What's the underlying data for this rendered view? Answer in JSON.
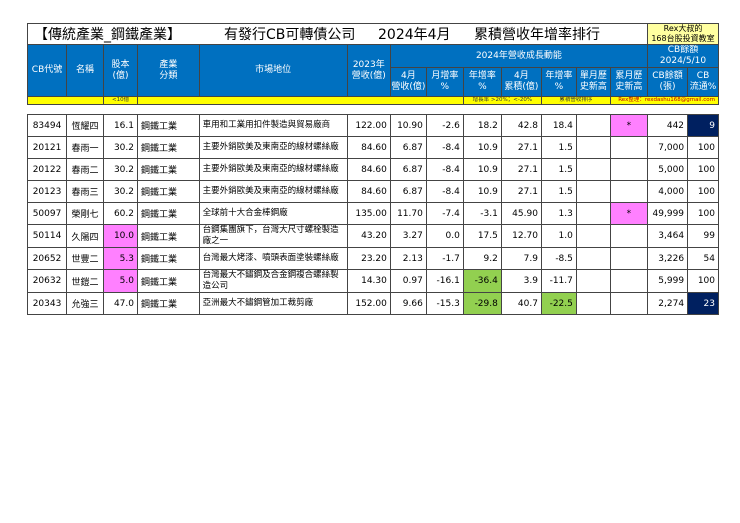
{
  "title": {
    "part1": "【傳統產業_鋼鐵產業】",
    "part2": "有發行CB可轉債公司",
    "part3": "2024年4月",
    "part4": "累積營收年增率排行"
  },
  "rex_box": {
    "line1": "Rex大叔的",
    "line2": "168台股投資教室"
  },
  "header": {
    "cb_code": "CB代號",
    "name": "名稱",
    "capital": "股本\n(億)",
    "industry": "產業\n分類",
    "position": "市場地位",
    "rev2023": "2023年\n營收(億)",
    "growth_group": "2024年營收成長動能",
    "apr_rev": "4月\n營收(億)",
    "mom": "月增率\n%",
    "yoy": "年增率\n%",
    "apr_cum": "4月\n累積(億)",
    "cum_yoy": "年增率\n%",
    "single_high": "單月歷\n史新高",
    "cum_high": "累月歷\n史新高",
    "cb_balance_title": "CB餘額",
    "cb_date": "2024/5/10",
    "cb_balance": "CB餘額\n(張)",
    "cb_flow": "CB\n流通%"
  },
  "legend": {
    "capital_note": "<10億",
    "growth_note": "增長率 >20%；<-20%",
    "cum_note": "累積營收排序",
    "author_note": "Rex整理：rexdashu168@gmail.com"
  },
  "rows": [
    {
      "code": "83494",
      "name": "恆耀四",
      "capital": "16.1",
      "industry": "鋼鐵工業",
      "position": "車用和工業用扣件製造與貿易廠商",
      "rev2023": "122.00",
      "apr_rev": "10.90",
      "mom": "-2.6",
      "yoy": "18.2",
      "apr_cum": "42.8",
      "cum_yoy": "18.4",
      "single_high": "",
      "cum_high": "*",
      "cb_balance": "442",
      "cb_flow": "9"
    },
    {
      "code": "20121",
      "name": "春雨一",
      "capital": "30.2",
      "industry": "鋼鐵工業",
      "position": "主要外銷歐美及東南亞的線材螺絲廠",
      "rev2023": "84.60",
      "apr_rev": "6.87",
      "mom": "-8.4",
      "yoy": "10.9",
      "apr_cum": "27.1",
      "cum_yoy": "1.5",
      "single_high": "",
      "cum_high": "",
      "cb_balance": "7,000",
      "cb_flow": "100"
    },
    {
      "code": "20122",
      "name": "春雨二",
      "capital": "30.2",
      "industry": "鋼鐵工業",
      "position": "主要外銷歐美及東南亞的線材螺絲廠",
      "rev2023": "84.60",
      "apr_rev": "6.87",
      "mom": "-8.4",
      "yoy": "10.9",
      "apr_cum": "27.1",
      "cum_yoy": "1.5",
      "single_high": "",
      "cum_high": "",
      "cb_balance": "5,000",
      "cb_flow": "100"
    },
    {
      "code": "20123",
      "name": "春雨三",
      "capital": "30.2",
      "industry": "鋼鐵工業",
      "position": "主要外銷歐美及東南亞的線材螺絲廠",
      "rev2023": "84.60",
      "apr_rev": "6.87",
      "mom": "-8.4",
      "yoy": "10.9",
      "apr_cum": "27.1",
      "cum_yoy": "1.5",
      "single_high": "",
      "cum_high": "",
      "cb_balance": "4,000",
      "cb_flow": "100"
    },
    {
      "code": "50097",
      "name": "榮剛七",
      "capital": "60.2",
      "industry": "鋼鐵工業",
      "position": "全球前十大合金棒鋼廠",
      "rev2023": "135.00",
      "apr_rev": "11.70",
      "mom": "-7.4",
      "yoy": "-3.1",
      "apr_cum": "45.90",
      "cum_yoy": "1.3",
      "single_high": "",
      "cum_high": "*",
      "cb_balance": "49,999",
      "cb_flow": "100"
    },
    {
      "code": "50114",
      "name": "久陽四",
      "capital": "10.0",
      "industry": "鋼鐵工業",
      "position": "台鋼集團旗下，台灣大尺寸螺栓製造廠之一",
      "rev2023": "43.20",
      "apr_rev": "3.27",
      "mom": "0.0",
      "yoy": "17.5",
      "apr_cum": "12.70",
      "cum_yoy": "1.0",
      "single_high": "",
      "cum_high": "",
      "cb_balance": "3,464",
      "cb_flow": "99"
    },
    {
      "code": "20652",
      "name": "世豐二",
      "capital": "5.3",
      "industry": "鋼鐵工業",
      "position": "台灣最大烤漆、噴頭表面塗裝螺絲廠",
      "rev2023": "23.20",
      "apr_rev": "2.13",
      "mom": "-1.7",
      "yoy": "9.2",
      "apr_cum": "7.9",
      "cum_yoy": "-8.5",
      "single_high": "",
      "cum_high": "",
      "cb_balance": "3,226",
      "cb_flow": "54"
    },
    {
      "code": "20632",
      "name": "世鎧二",
      "capital": "5.0",
      "industry": "鋼鐵工業",
      "position": "台灣最大不鏽鋼及合金鋼複合螺絲製造公司",
      "rev2023": "14.30",
      "apr_rev": "0.97",
      "mom": "-16.1",
      "yoy": "-36.4",
      "apr_cum": "3.9",
      "cum_yoy": "-11.7",
      "single_high": "",
      "cum_high": "",
      "cb_balance": "5,999",
      "cb_flow": "100"
    },
    {
      "code": "20343",
      "name": "允強三",
      "capital": "47.0",
      "industry": "鋼鐵工業",
      "position": "亞洲最大不鏽鋼管加工裁剪廠",
      "rev2023": "152.00",
      "apr_rev": "9.66",
      "mom": "-15.3",
      "yoy": "-29.8",
      "apr_cum": "40.7",
      "cum_yoy": "-22.5",
      "single_high": "",
      "cum_high": "",
      "cb_balance": "2,274",
      "cb_flow": "23"
    }
  ],
  "highlights": {
    "capital_pink_rows": [
      5,
      6,
      7
    ],
    "yoy_green_rows": [
      7,
      8
    ],
    "cum_yoy_green_rows": [
      8
    ],
    "cum_high_pink_rows": [
      0,
      4
    ],
    "cb_flow_navy_rows": [
      0,
      8
    ]
  },
  "colors": {
    "header_blue": "#0070c0",
    "legend_yellow": "#ffff00",
    "highlight_pink": "#ff80ff",
    "highlight_green": "#92d050",
    "highlight_navy": "#002060",
    "rex_box_yellow": "#ffffa0"
  }
}
